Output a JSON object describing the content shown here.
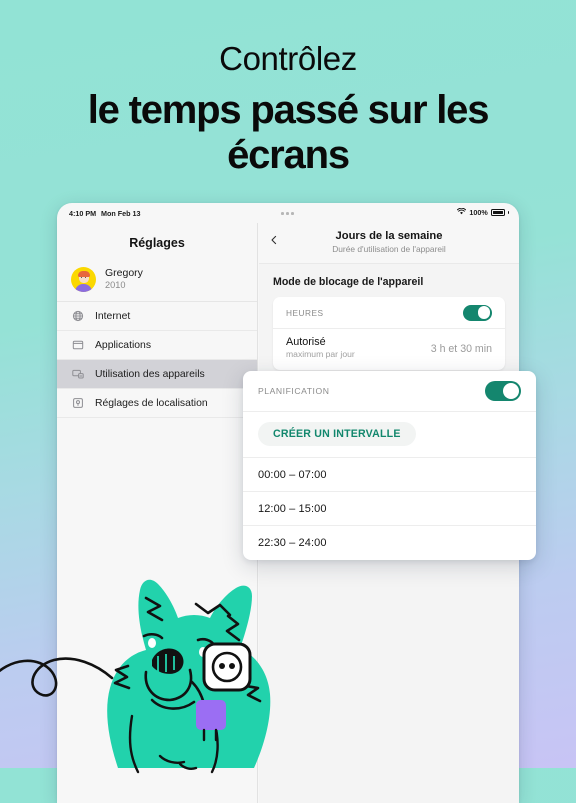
{
  "headline": {
    "line1": "Contrôlez",
    "line2": "le temps passé sur les écrans"
  },
  "colors": {
    "bg_top": "#92e3d5",
    "bg_bottom": "#c8c4f5",
    "accent_green": "#14866e",
    "button_text_green": "#12876d",
    "mascot_body": "#22d2ac",
    "plug_purple": "#9b6ef3"
  },
  "device": {
    "status_bar": {
      "time": "4:10 PM",
      "date": "Mon Feb 13",
      "battery_percent": "100%",
      "wifi_icon": "wifi-icon",
      "battery_icon": "battery-full-icon",
      "dots_icon": "three-dots-icon"
    },
    "sidebar": {
      "title": "Réglages",
      "profile": {
        "name": "Gregory",
        "year": "2010",
        "avatar_icon": "avatar"
      },
      "items": [
        {
          "label": "Internet",
          "icon": "globe-icon",
          "active": false
        },
        {
          "label": "Applications",
          "icon": "window-icon",
          "active": false
        },
        {
          "label": "Utilisation des appareils",
          "icon": "device-usage-icon",
          "active": true
        },
        {
          "label": "Réglages de localisation",
          "icon": "location-icon",
          "active": false
        }
      ]
    },
    "pane": {
      "back_icon": "chevron-left-icon",
      "title": "Jours de la semaine",
      "subtitle": "Durée d'utilisation de l'appareil",
      "section_title": "Mode de blocage de l'appareil",
      "hours_card": {
        "caption": "HEURES",
        "toggle_on": true,
        "row_title": "Autorisé",
        "row_subtitle": "maximum par jour",
        "row_value": "3 h et 30 min"
      }
    },
    "planning_card": {
      "caption": "PLANIFICATION",
      "toggle_on": true,
      "create_button": "CRÉER UN INTERVALLE",
      "intervals": [
        "00:00  –  07:00",
        "12:00  –  15:00",
        "22:30  –  24:00"
      ]
    }
  },
  "illustration": {
    "mascot_icon": "dog-mascot-with-plug",
    "socket_icon": "wall-socket-icon"
  }
}
